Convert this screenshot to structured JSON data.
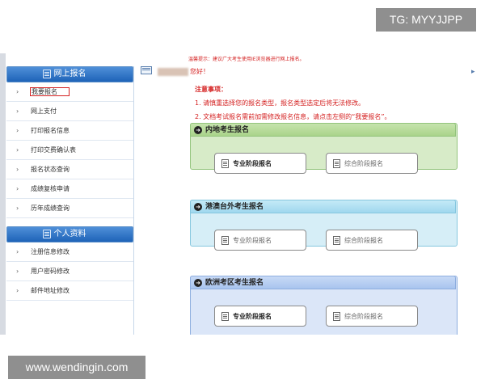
{
  "watermarks": {
    "top": "TG: MYYJJPP",
    "bottom": "www.wendingin.com"
  },
  "sidebar": {
    "section1_title": "网上报名",
    "items1": [
      {
        "label": "我要报名",
        "active": true
      },
      {
        "label": "网上支付"
      },
      {
        "label": "打印报名信息"
      },
      {
        "label": "打印交费确认表"
      },
      {
        "label": "报名状态查询"
      },
      {
        "label": "成绩复核申请"
      },
      {
        "label": "历年成绩查询"
      }
    ],
    "section2_title": "个人资料",
    "items2": [
      {
        "label": "注册信息修改"
      },
      {
        "label": "用户密码修改"
      },
      {
        "label": "邮件地址修改"
      }
    ]
  },
  "main": {
    "tip": "温馨提示：建议广大考生使用IE浏览器进行网上报名。",
    "greeting": "您好！",
    "notice": {
      "title": "注意事项：",
      "line1": "1. 请慎重选择您的报名类型，报名类型选定后将无法修改。",
      "line2": "2. 文档考试报名需前加需修改报名信息，请点击左侧的“我要报名”。"
    },
    "panels": [
      {
        "title": "内地考生报名",
        "btn_a": "专业阶段报名",
        "btn_b": "综合阶段报名"
      },
      {
        "title": "港澳台外考生报名",
        "btn_a": "专业阶段报名",
        "btn_b": "综合阶段报名"
      },
      {
        "title": "欧洲考区考生报名",
        "btn_a": "专业阶段报名",
        "btn_b": "综合阶段报名"
      }
    ]
  },
  "icons": {
    "section": "document-icon",
    "arrow": "arrow-right-icon",
    "mail": "mail-icon"
  },
  "colors": {
    "accent": "#1e63b8",
    "notice_red": "#d42020",
    "panel_green": "#d7ebc8",
    "panel_cyan": "#d6eef7",
    "panel_blue": "#dbe6f8"
  }
}
